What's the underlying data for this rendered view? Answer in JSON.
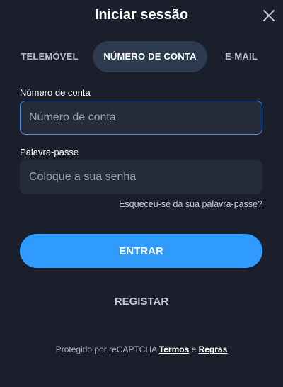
{
  "header": {
    "title": "Iniciar sessão",
    "close_icon": "close-icon"
  },
  "tabs": [
    {
      "label": "TELEMÓVEL",
      "active": false
    },
    {
      "label": "NÚMERO DE CONTA",
      "active": true
    },
    {
      "label": "E-MAIL",
      "active": false
    }
  ],
  "form": {
    "account_label": "Número de conta",
    "account_placeholder": "Número de conta",
    "account_value": "",
    "password_label": "Palavra-passe",
    "password_placeholder": "Coloque a sua senha",
    "password_value": "",
    "forgot_link": "Esqueceu-se da sua palavra-passe?"
  },
  "actions": {
    "enter_label": "ENTRAR",
    "register_label": "REGISTAR"
  },
  "footer": {
    "prefix": "Protegido por reCAPTCHA ",
    "terms": "Termos",
    "and": " e ",
    "rules": "Regras"
  },
  "colors": {
    "background": "#1b1f2b",
    "accent": "#2f9bff",
    "active_tab": "#2d3a4f",
    "focus_border": "#4f8ee6"
  }
}
